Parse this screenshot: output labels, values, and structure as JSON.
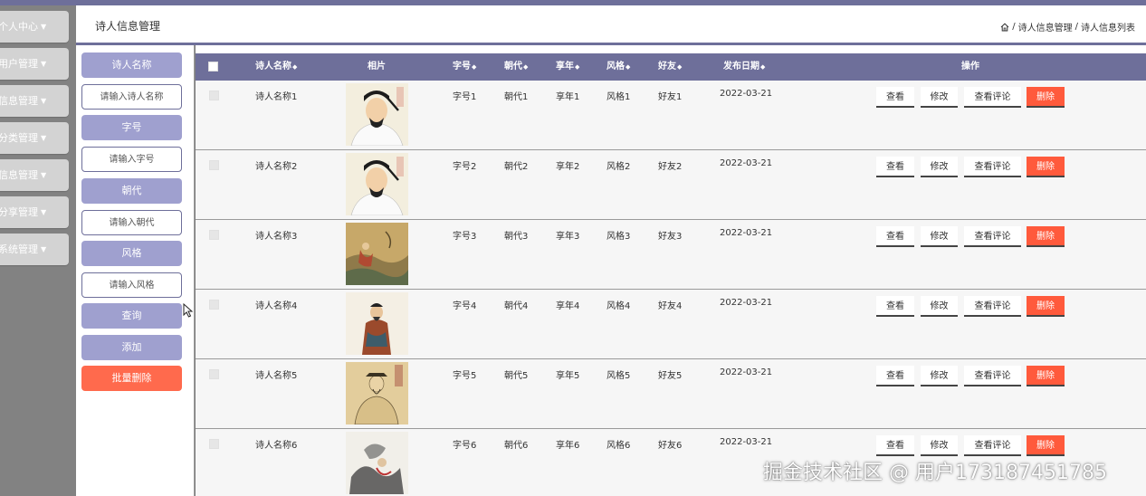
{
  "sidebar": {
    "items": [
      {
        "label": "个人中心"
      },
      {
        "label": "用户管理"
      },
      {
        "label": "诗词信息管理"
      },
      {
        "label": "分类管理"
      },
      {
        "label": "诗人信息管理"
      },
      {
        "label": "诗人分享管理"
      },
      {
        "label": "系统管理"
      }
    ]
  },
  "header": {
    "title": "诗人信息管理",
    "breadcrumb": [
      "诗人信息管理",
      "诗人信息列表"
    ],
    "separator": "/"
  },
  "search": {
    "name_label": "诗人名称",
    "name_placeholder": "请输入诗人名称",
    "zihao_label": "字号",
    "zihao_placeholder": "请输入字号",
    "dynasty_label": "朝代",
    "dynasty_placeholder": "请输入朝代",
    "style_label": "风格",
    "style_placeholder": "请输入风格",
    "query_button": "查询",
    "add_button": "添加",
    "batch_delete_button": "批量删除"
  },
  "table": {
    "columns": {
      "name": "诗人名称",
      "photo": "相片",
      "zihao": "字号",
      "dynasty": "朝代",
      "age": "享年",
      "style": "风格",
      "friend": "好友",
      "date": "发布日期",
      "ops": "操作"
    },
    "sort_glyph": "◆",
    "actions": {
      "view": "查看",
      "edit": "修改",
      "comments": "查看评论",
      "delete": "删除"
    },
    "rows": [
      {
        "name": "诗人名称1",
        "zihao": "字号1",
        "dynasty": "朝代1",
        "age": "享年1",
        "style": "风格1",
        "friend": "好友1",
        "date": "2022-03-21"
      },
      {
        "name": "诗人名称2",
        "zihao": "字号2",
        "dynasty": "朝代2",
        "age": "享年2",
        "style": "风格2",
        "friend": "好友2",
        "date": "2022-03-21"
      },
      {
        "name": "诗人名称3",
        "zihao": "字号3",
        "dynasty": "朝代3",
        "age": "享年3",
        "style": "风格3",
        "friend": "好友3",
        "date": "2022-03-21"
      },
      {
        "name": "诗人名称4",
        "zihao": "字号4",
        "dynasty": "朝代4",
        "age": "享年4",
        "style": "风格4",
        "friend": "好友4",
        "date": "2022-03-21"
      },
      {
        "name": "诗人名称5",
        "zihao": "字号5",
        "dynasty": "朝代5",
        "age": "享年5",
        "style": "风格5",
        "friend": "好友5",
        "date": "2022-03-21"
      },
      {
        "name": "诗人名称6",
        "zihao": "字号6",
        "dynasty": "朝代6",
        "age": "享年6",
        "style": "风格6",
        "friend": "好友6",
        "date": "2022-03-21"
      }
    ]
  },
  "watermark": "掘金技术社区 @ 用户173187451785",
  "colors": {
    "accent": "#6e6f9a",
    "label_bg": "#9fa0cf",
    "danger": "#ff5a3c"
  }
}
